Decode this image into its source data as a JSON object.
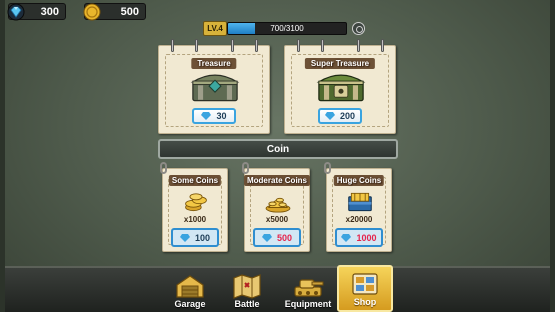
{
  "currency": {
    "gems": "300",
    "coins": "500"
  },
  "level": {
    "badge": "LV.4",
    "xp_text": "700/3100",
    "progress": 0.2258
  },
  "chests": [
    {
      "title": "Treasure",
      "price": "30"
    },
    {
      "title": "Super Treasure",
      "price": "200"
    }
  ],
  "coin_section": {
    "title": "Coin"
  },
  "coin_packs": [
    {
      "title": "Some Coins",
      "amount": "x1000",
      "price": "100",
      "price_color": "#1d3d57"
    },
    {
      "title": "Moderate Coins",
      "amount": "x5000",
      "price": "500",
      "price_color": "#e5254d"
    },
    {
      "title": "Huge Coins",
      "amount": "x20000",
      "price": "1000",
      "price_color": "#e5254d"
    }
  ],
  "nav": [
    {
      "label": "Garage",
      "icon": "garage-icon"
    },
    {
      "label": "Battle",
      "icon": "battle-map-icon"
    },
    {
      "label": "Equipment",
      "icon": "equipment-icon"
    },
    {
      "label": "Shop",
      "icon": "shop-icon",
      "active": true
    }
  ],
  "colors": {
    "accent_blue": "#3aa4e0",
    "gold": "#d8b23a",
    "active_tab": "#f6d45a",
    "price_red": "#e5254d"
  }
}
